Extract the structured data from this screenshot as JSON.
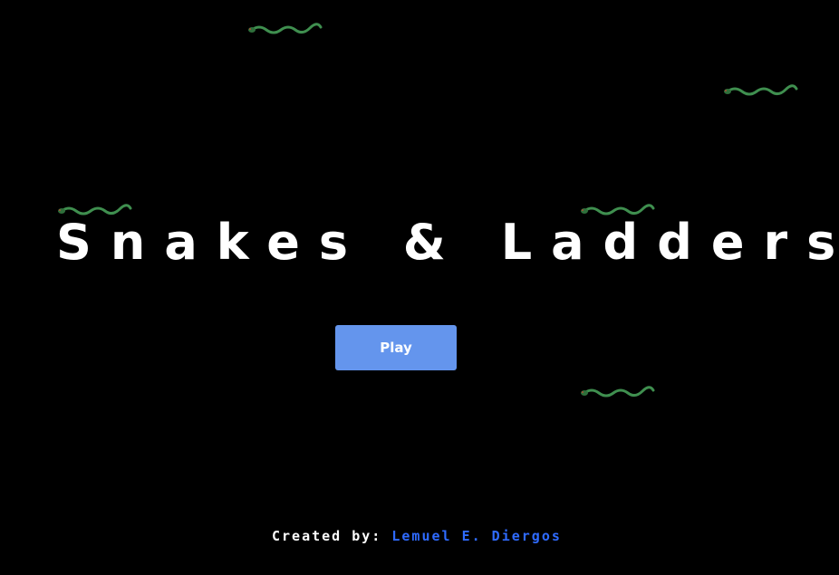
{
  "game": {
    "title": "Snakes & Ladders",
    "play_label": "Play",
    "credit_label": "Created by:",
    "credit_author": "Lemuel E. Diergos"
  },
  "colors": {
    "background": "#000000",
    "button": "#6495ed",
    "author": "#2f6bff",
    "snake": "#3f8f4f"
  },
  "icons": [
    "snake-sprite-icon"
  ]
}
